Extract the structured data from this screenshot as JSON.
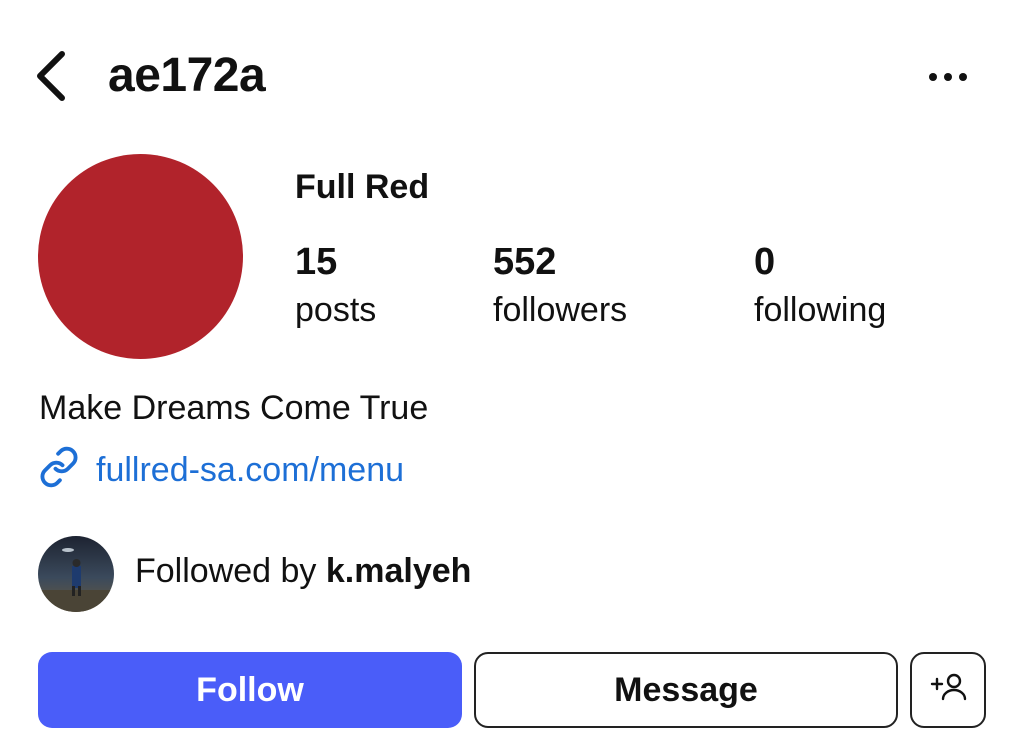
{
  "header": {
    "username": "ae172a",
    "back_icon": "chevron-left-icon",
    "more_icon": "ellipsis-icon"
  },
  "profile": {
    "avatar_color": "#b1232b",
    "display_name": "Full Red",
    "stats": [
      {
        "value": "15",
        "label": "posts"
      },
      {
        "value": "552",
        "label": "followers"
      },
      {
        "value": "0",
        "label": "following"
      }
    ],
    "bio": "Make Dreams Come True",
    "link": {
      "icon": "link-icon",
      "text": "fullred-sa.com/menu",
      "color": "#1d6fd6"
    }
  },
  "followed_by": {
    "prefix": "Followed by ",
    "username": "k.malyeh"
  },
  "actions": {
    "follow_label": "Follow",
    "follow_color": "#4a5df9",
    "message_label": "Message",
    "suggest_icon": "add-person-icon"
  }
}
